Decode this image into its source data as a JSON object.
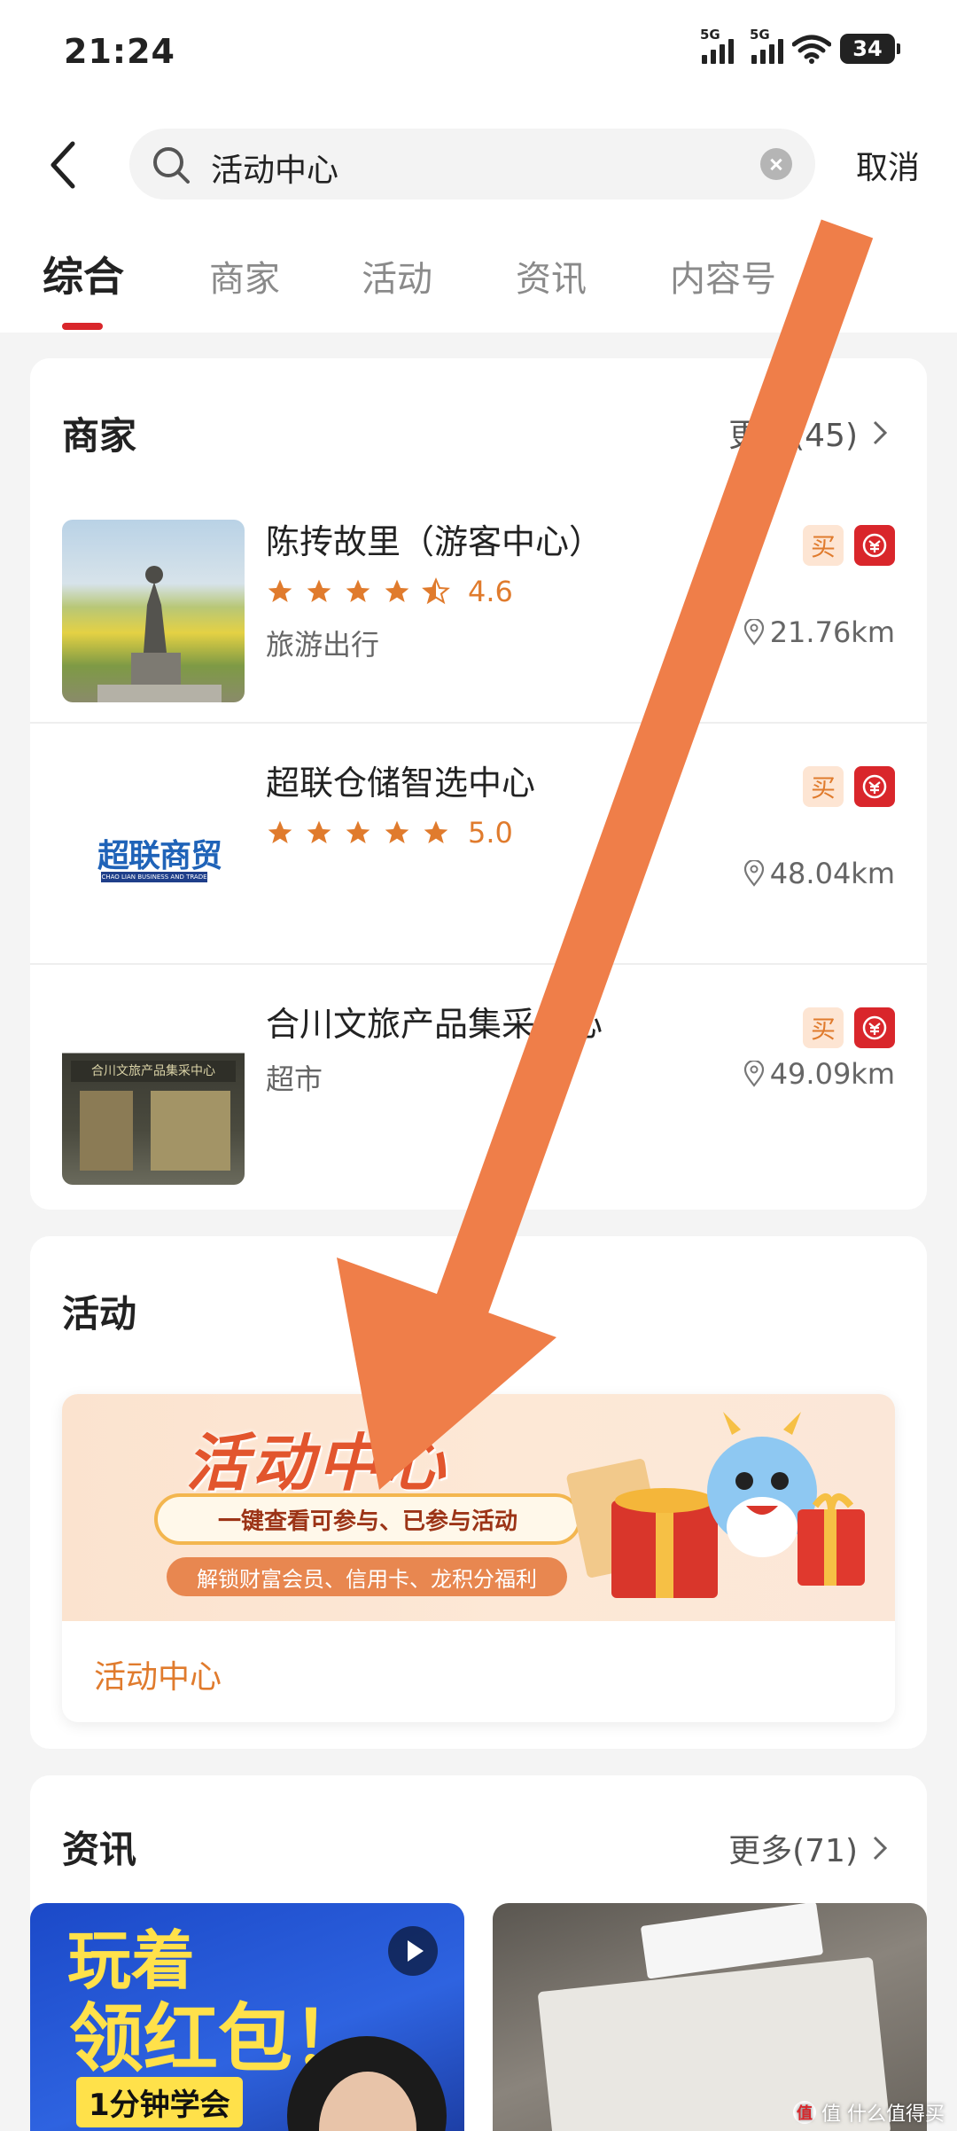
{
  "status_bar": {
    "time": "21:24",
    "signal1": "5G",
    "signal2": "5G",
    "battery": "34"
  },
  "search": {
    "query": "活动中心",
    "cancel": "取消"
  },
  "tabs": [
    {
      "label": "综合"
    },
    {
      "label": "商家"
    },
    {
      "label": "活动"
    },
    {
      "label": "资讯"
    },
    {
      "label": "内容号"
    }
  ],
  "merchants_section": {
    "title": "商家",
    "more": "更多(45)",
    "items": [
      {
        "name": "陈抟故里（游客中心）",
        "rating": "4.6",
        "category": "旅游出行",
        "distance": "21.76km",
        "buy_badge": "买"
      },
      {
        "name": "超联仓储智选中心",
        "rating": "5.0",
        "category": "",
        "distance": "48.04km",
        "buy_badge": "买",
        "logo_text": "超联商贸",
        "logo_sub": "CHAO LIAN BUSINESS AND TRADE"
      },
      {
        "name": "合川文旅产品集采中心",
        "rating": "",
        "category": "超市",
        "distance": "49.09km",
        "buy_badge": "买",
        "sign_text": "合川文旅产品集采中心"
      }
    ]
  },
  "activity_section": {
    "title": "活动",
    "banner": {
      "title": "活动中心",
      "pill": "一键查看可参与、已参与活动",
      "sub": "解锁财富会员、信用卡、龙积分福利"
    },
    "caption": "活动中心"
  },
  "news_section": {
    "title": "资讯",
    "more": "更多(71)",
    "left": {
      "line1": "玩着",
      "line2": "领红包！",
      "line3": "1分钟学会"
    }
  },
  "watermark": "值 什么值得买",
  "colors": {
    "accent": "#d9262b",
    "orange": "#e07b2d",
    "arrow": "#ef7e49"
  }
}
